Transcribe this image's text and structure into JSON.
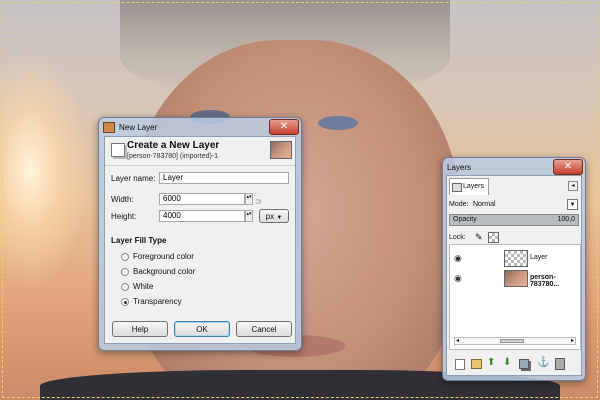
{
  "new_layer_dialog": {
    "window_title": "New Layer",
    "heading": "Create a New Layer",
    "subheading": "[person-783780] (imported)-1",
    "layer_name_label": "Layer name:",
    "layer_name_value": "Layer",
    "width_label": "Width:",
    "width_value": "6000",
    "height_label": "Height:",
    "height_value": "4000",
    "unit": "px",
    "fill_type_title": "Layer Fill Type",
    "fill_options": [
      {
        "label": "Foreground color",
        "selected": false
      },
      {
        "label": "Background color",
        "selected": false
      },
      {
        "label": "White",
        "selected": false
      },
      {
        "label": "Transparency",
        "selected": true
      }
    ],
    "help_label": "Help",
    "ok_label": "OK",
    "cancel_label": "Cancel"
  },
  "layers_panel": {
    "window_title": "Layers",
    "tab_label": "Layers",
    "mode_label": "Mode:",
    "mode_value": "Normal",
    "opacity_label": "Opacity",
    "opacity_value": "100,0",
    "lock_label": "Lock:",
    "layers": [
      {
        "name": "Layer"
      },
      {
        "name": "person-783780..."
      }
    ]
  }
}
